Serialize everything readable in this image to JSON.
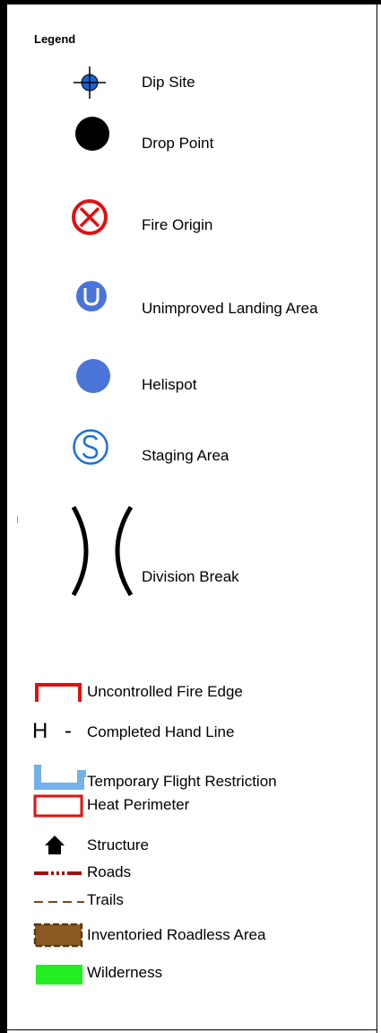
{
  "legend": {
    "title": "Legend",
    "point_symbols": [
      {
        "label": "Dip Site",
        "icon": "crosshair-icon",
        "color": "#1a5fd6"
      },
      {
        "label": "Drop Point",
        "icon": "filled-circle-icon",
        "color": "#000000"
      },
      {
        "label": "Fire Origin",
        "icon": "circled-x-icon",
        "color": "#e01010"
      },
      {
        "label": "Unimproved Landing Area",
        "icon": "circled-u-icon",
        "color": "#4a74d8"
      },
      {
        "label": "Helispot",
        "icon": "blue-circle-icon",
        "color": "#4a74d8"
      },
      {
        "label": "Staging Area",
        "icon": "circled-s-icon",
        "color": "#1a6fe0"
      },
      {
        "label": "Division Break",
        "icon": "division-break-icon",
        "color": "#000000"
      }
    ],
    "line_symbols": [
      {
        "label": "Uncontrolled Fire Edge",
        "icon": "fire-edge-icon",
        "color": "#e01010"
      },
      {
        "label": "Completed Hand Line",
        "icon": "hand-line-icon",
        "symbol_text": "H -",
        "color": "#000000"
      },
      {
        "label": "Temporary Flight Restriction",
        "icon": "flight-restriction-icon",
        "color": "#74b0ea"
      },
      {
        "label": "Heat Perimeter",
        "icon": "heat-perimeter-icon",
        "color": "#e01010"
      },
      {
        "label": "Structure",
        "icon": "house-icon",
        "color": "#000000"
      },
      {
        "label": "Roads",
        "icon": "road-line-icon",
        "color": "#a01010"
      },
      {
        "label": "Trails",
        "icon": "trail-line-icon",
        "color": "#7a4a1a"
      },
      {
        "label": "Inventoried Roadless Area",
        "icon": "roadless-area-icon",
        "color": "#8a5a22"
      },
      {
        "label": "Wilderness",
        "icon": "wilderness-icon",
        "color": "#22ee22"
      }
    ]
  }
}
